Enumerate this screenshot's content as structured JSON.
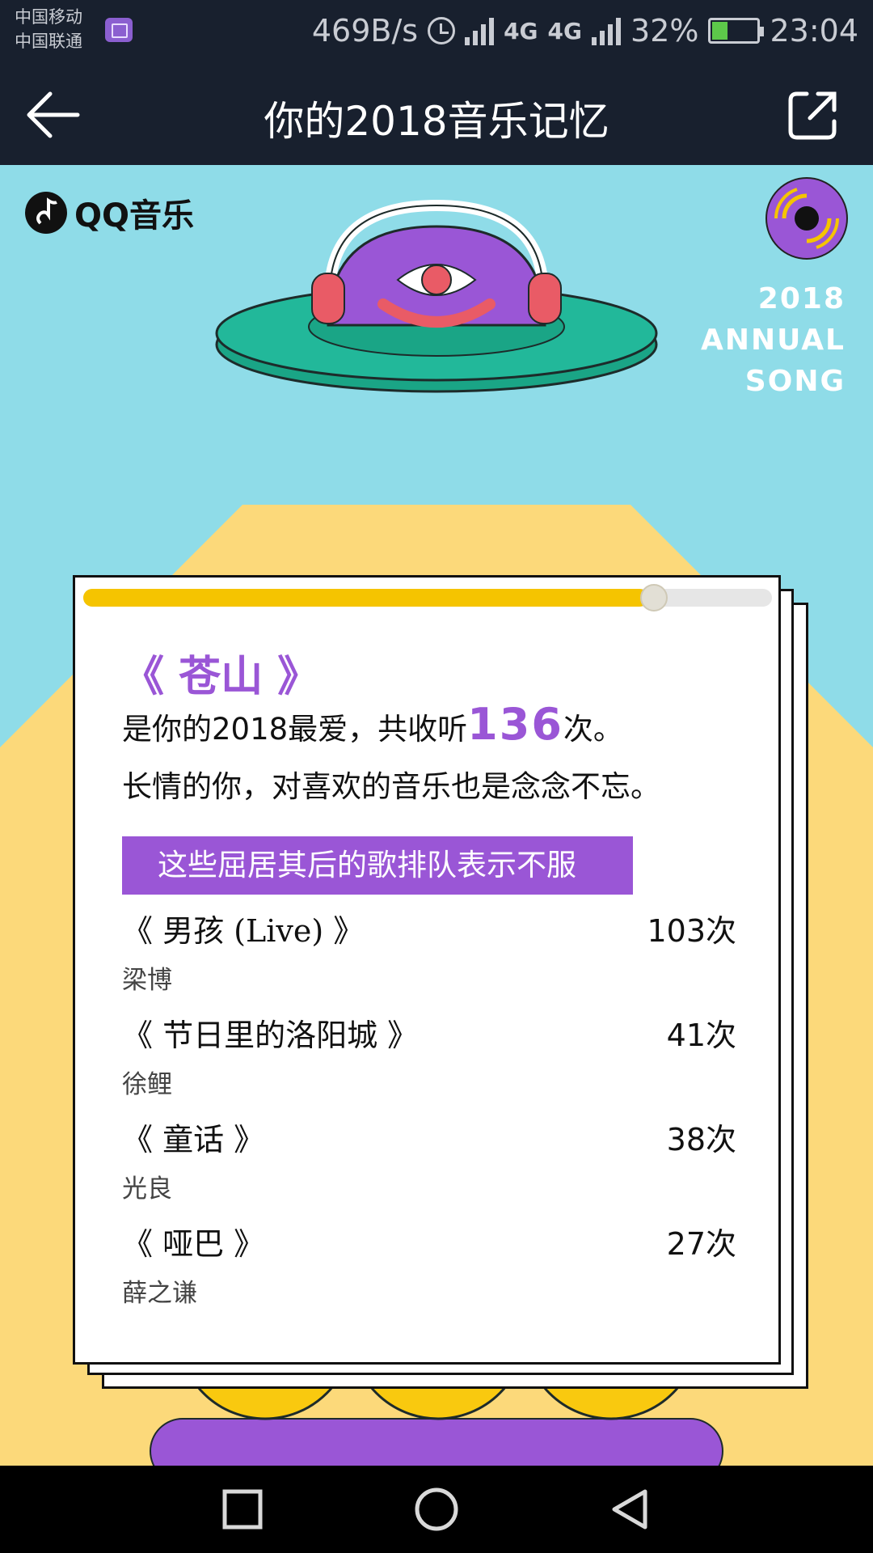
{
  "status_bar": {
    "carrier_1": "中国移动",
    "carrier_2": "中国联通",
    "net_speed": "469B/s",
    "net_gen_1": "4G",
    "net_gen_2": "4G",
    "battery": "32%",
    "battery_level": 0.32,
    "time": "23:04"
  },
  "header": {
    "title": "你的2018音乐记忆"
  },
  "brand": {
    "name": "QQ音乐",
    "tag_lines": [
      "2018",
      "ANNUAL",
      "SONG"
    ]
  },
  "card": {
    "progress": 0.82,
    "top_song": "《 苍山 》",
    "line1_prefix": "是你的2018最爱，共收听",
    "play_count": "136",
    "line1_suffix": "次。",
    "line2": "长情的你，对喜欢的音乐也是念念不忘。",
    "banner": "这些屈居其后的歌排队表示不服",
    "runners": [
      {
        "title": "《 男孩 (Live) 》",
        "count": "103次",
        "artist": "梁博"
      },
      {
        "title": "《 节日里的洛阳城 》",
        "count": "41次",
        "artist": "徐鲤"
      },
      {
        "title": "《 童话 》",
        "count": "38次",
        "artist": "光良"
      },
      {
        "title": "《 哑巴 》",
        "count": "27次",
        "artist": "薛之谦"
      }
    ]
  },
  "colors": {
    "sky": "#8fdce8",
    "sand": "#fcd97a",
    "accent_purple": "#9a56d6",
    "progress_yellow": "#f5c400",
    "ufo_green": "#22b89a",
    "face_yellow": "#f9c90f"
  },
  "icons": {
    "back": "arrow-left-icon",
    "share": "share-external-icon",
    "nav": [
      "square-icon",
      "circle-icon",
      "triangle-back-icon"
    ]
  }
}
